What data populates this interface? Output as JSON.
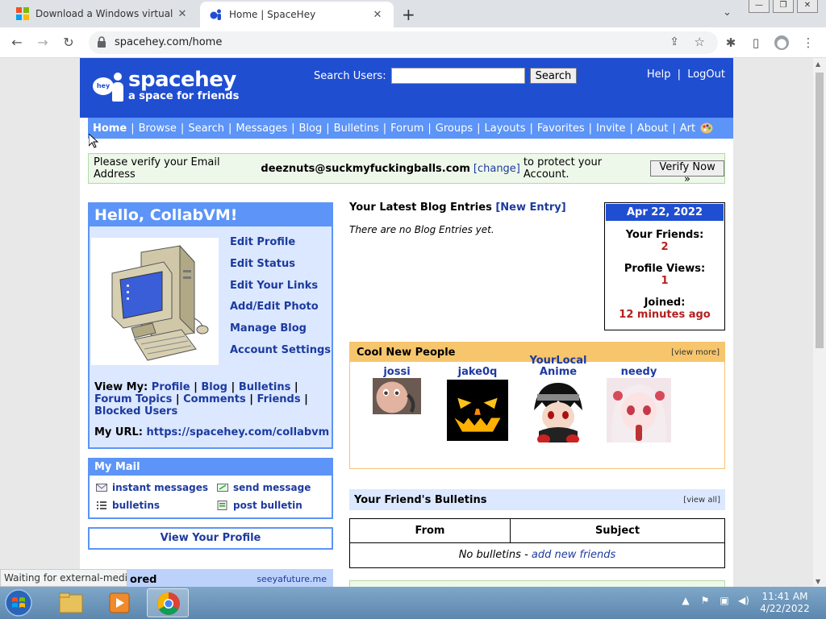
{
  "browser": {
    "tabs": [
      {
        "title": "Download a Windows virtual ma"
      },
      {
        "title": "Home | SpaceHey"
      }
    ],
    "url": "spacehey.com/home"
  },
  "header": {
    "logo_name": "spacehey",
    "logo_tagline": "a space for friends",
    "logo_bubble": "hey",
    "search_label": "Search Users:",
    "search_button": "Search",
    "help": "Help",
    "sep": "|",
    "logout": "LogOut"
  },
  "nav": {
    "items": [
      "Home",
      "Browse",
      "Search",
      "Messages",
      "Blog",
      "Bulletins",
      "Forum",
      "Groups",
      "Layouts",
      "Favorites",
      "Invite",
      "About",
      "Art"
    ]
  },
  "verify": {
    "text_before": "Please verify your Email Address",
    "email": "deeznuts@suckmyfuckingballs.com",
    "change": "[change]",
    "text_after": "to protect your Account.",
    "button": "Verify Now »"
  },
  "profile": {
    "hello": "Hello, CollabVM!",
    "edit_links": [
      "Edit Profile",
      "Edit Status",
      "Edit Your Links",
      "Add/Edit Photo",
      "Manage Blog",
      "Account Settings"
    ],
    "view_my_label": "View My:",
    "view_my_links": [
      "Profile",
      "Blog",
      "Bulletins",
      "Forum Topics",
      "Comments",
      "Friends",
      "Blocked Users"
    ],
    "url_label": "My URL:",
    "url": "https://spacehey.com/collabvm"
  },
  "mail": {
    "title": "My Mail",
    "items": [
      "instant messages",
      "send message",
      "bulletins",
      "post bulletin"
    ]
  },
  "view_profile": "View Your Profile",
  "sponsored": {
    "title": "ored",
    "link": "seeyafuture.me"
  },
  "blog": {
    "title": "Your Latest Blog Entries",
    "new_entry": "[New Entry]",
    "none": "There are no Blog Entries yet."
  },
  "stats": {
    "date": "Apr 22, 2022",
    "friends_label": "Your Friends:",
    "friends": "2",
    "views_label": "Profile Views:",
    "views": "1",
    "joined_label": "Joined:",
    "joined": "12 minutes ago"
  },
  "cool": {
    "title": "Cool New People",
    "view_more": "[view more]",
    "people": [
      "jossi",
      "jake0q",
      "YourLocalAnime",
      "needy"
    ]
  },
  "bulletins": {
    "title": "Your Friend's Bulletins",
    "view_all": "[view all]",
    "col_from": "From",
    "col_subject": "Subject",
    "none_text": "No bulletins -",
    "add_friends": "add new friends"
  },
  "status_bar": "Waiting for external-medi...",
  "clock": {
    "time": "11:41 AM",
    "date": "4/22/2022"
  },
  "colors": {
    "brand_blue": "#1f4ed1",
    "nav_blue": "#5c94f7",
    "link": "#1d3a9e",
    "stat_red": "#b32020",
    "cool_orange": "#f7c66c"
  }
}
